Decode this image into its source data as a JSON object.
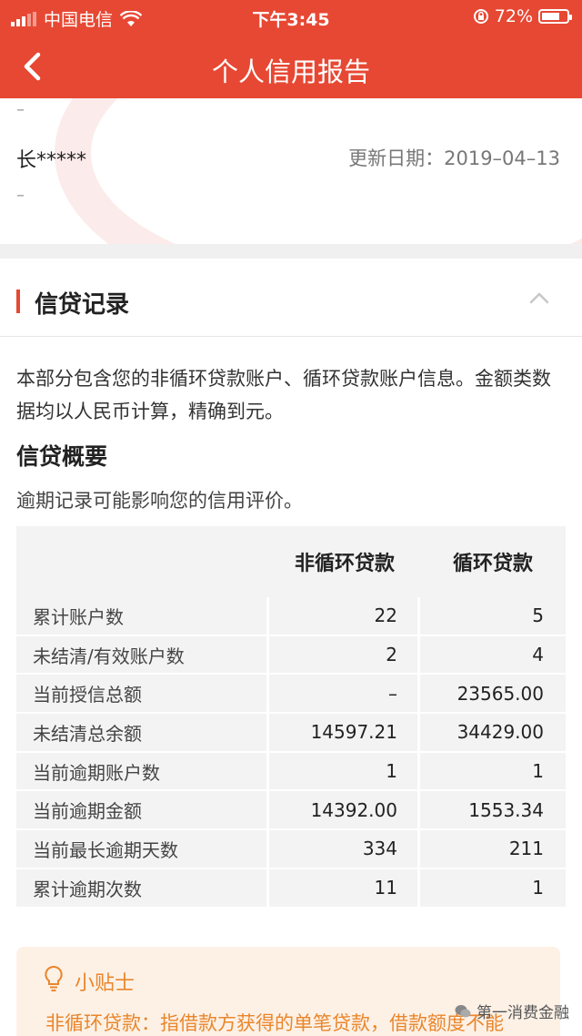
{
  "status": {
    "carrier": "中国电信",
    "time": "下午3:45",
    "battery": "72%",
    "battery_level": 0.72
  },
  "nav": {
    "title": "个人信用报告"
  },
  "profile": {
    "dash_top": "–",
    "name": "长*****",
    "update_date": "更新日期：2019–04–13",
    "dash_bottom": "–"
  },
  "section": {
    "title": "信贷记录",
    "description": "本部分包含您的非循环贷款账户、循环贷款账户信息。金额类数据均以人民币计算，精确到元。",
    "sub_title": "信贷概要",
    "hint": "逾期记录可能影响您的信用评价。"
  },
  "table": {
    "headers": [
      "",
      "非循环贷款",
      "循环贷款"
    ],
    "rows": [
      [
        "累计账户数",
        "22",
        "5"
      ],
      [
        "未结清/有效账户数",
        "2",
        "4"
      ],
      [
        "当前授信总额",
        "–",
        "23565.00"
      ],
      [
        "未结清总余额",
        "14597.21",
        "34429.00"
      ],
      [
        "当前逾期账户数",
        "1",
        "1"
      ],
      [
        "当前逾期金额",
        "14392.00",
        "1553.34"
      ],
      [
        "当前最长逾期天数",
        "334",
        "211"
      ],
      [
        "累计逾期次数",
        "11",
        "1"
      ]
    ]
  },
  "tips": {
    "title": "小贴士",
    "text": "非循环贷款：指借款方获得的单笔贷款，借款额度不能"
  },
  "brand": {
    "name": "第一消费金融"
  },
  "colors": {
    "accent": "#e74833",
    "tip": "#e9862c"
  }
}
